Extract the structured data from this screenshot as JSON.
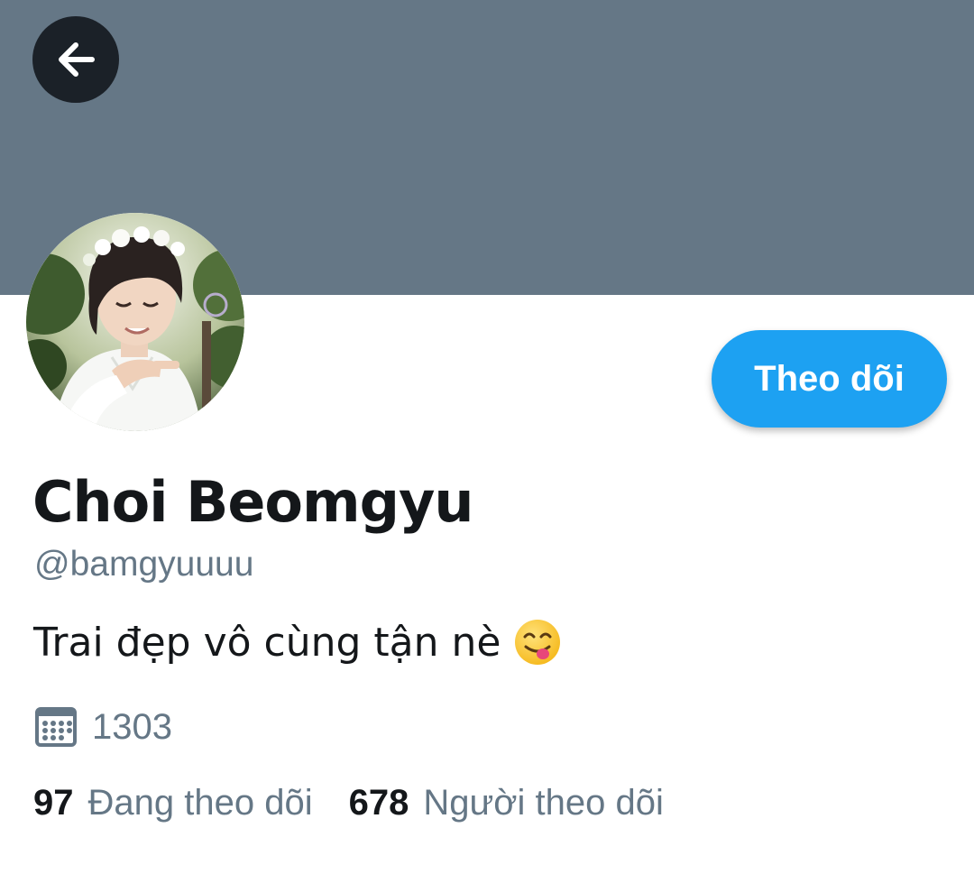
{
  "header": {
    "back_icon": "arrow-left-icon",
    "banner_color": "#657786"
  },
  "profile": {
    "display_name": "Choi Beomgyu",
    "handle": "@bamgyuuuu",
    "bio": "Trai đẹp vô cùng tận nè",
    "bio_emoji": "yum-face-emoji",
    "joined_icon": "calendar-icon",
    "joined": "1303"
  },
  "actions": {
    "follow_label": "Theo dõi",
    "follow_color": "#1da1f2"
  },
  "stats": {
    "following_count": "97",
    "following_label": "Đang theo dõi",
    "followers_count": "678",
    "followers_label": "Người theo dõi"
  },
  "colors": {
    "text_primary": "#14171a",
    "text_secondary": "#657786"
  }
}
